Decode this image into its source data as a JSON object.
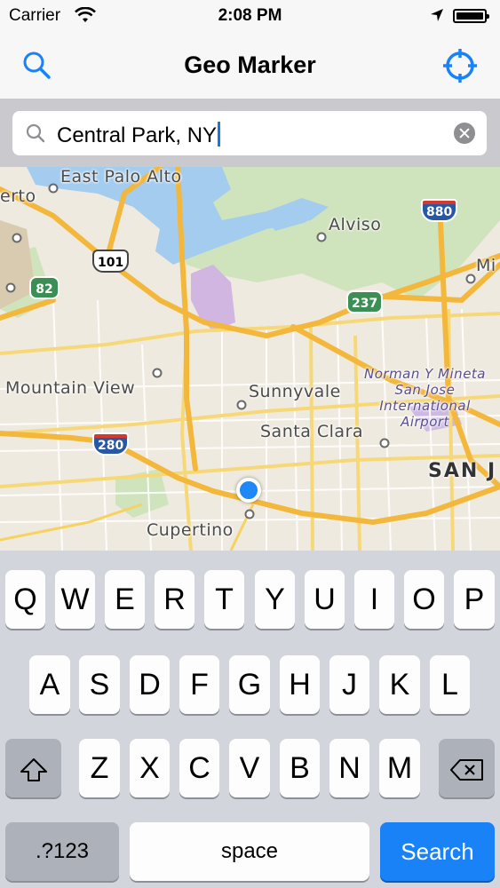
{
  "status_bar": {
    "carrier": "Carrier",
    "time": "2:08 PM"
  },
  "nav": {
    "title": "Geo Marker",
    "left_icon": "search-icon",
    "right_icon": "crosshair-locate-icon"
  },
  "search": {
    "value": "Central Park, NY",
    "icon": "magnifier-icon",
    "clear_icon": "clear-x-icon"
  },
  "map": {
    "labels": {
      "east_palo_alto": "East Palo Alto",
      "alviso": "Alviso",
      "mountain_view": "Mountain View",
      "sunnyvale": "Sunnyvale",
      "santa_clara": "Santa Clara",
      "cupertino": "Cupertino",
      "san_jose": "SAN J",
      "milpitas": "Mi",
      "edge_left": "erto",
      "airport_line1": "Norman Y Mineta",
      "airport_line2": "San Jose",
      "airport_line3": "International",
      "airport_line4": "Airport"
    },
    "shields": {
      "i880": "880",
      "us101": "101",
      "ca82": "82",
      "ca237": "237",
      "i280": "280"
    },
    "colors": {
      "water": "#a3ccef",
      "park": "#c8ddb4",
      "highway": "#f6c04f",
      "user_location": "#1e88f5"
    }
  },
  "keyboard": {
    "row1": [
      "Q",
      "W",
      "E",
      "R",
      "T",
      "Y",
      "U",
      "I",
      "O",
      "P"
    ],
    "row2": [
      "A",
      "S",
      "D",
      "F",
      "G",
      "H",
      "J",
      "K",
      "L"
    ],
    "row3": [
      "Z",
      "X",
      "C",
      "V",
      "B",
      "N",
      "M"
    ],
    "numbers_key": ".?123",
    "space_key": "space",
    "search_key": "Search",
    "shift_icon": "shift-arrow-icon",
    "delete_icon": "backspace-icon"
  }
}
